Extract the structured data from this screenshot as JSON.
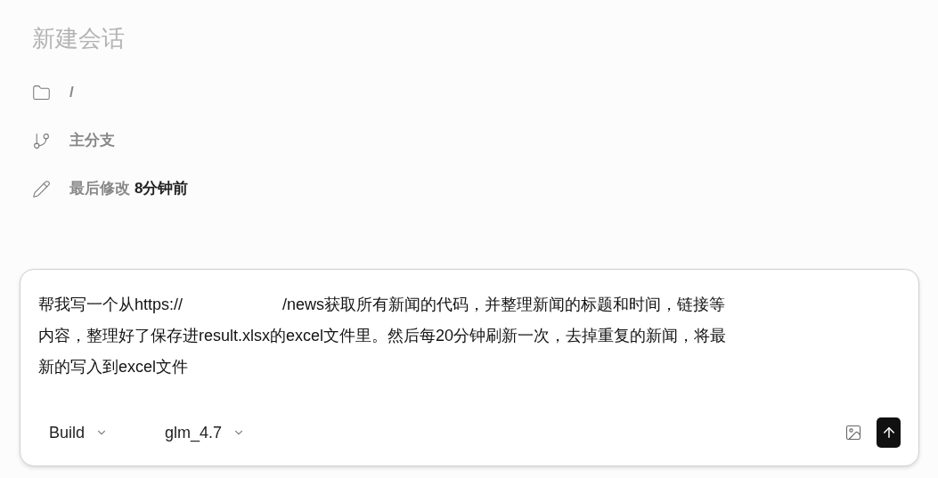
{
  "title": "新建会话",
  "info": [
    {
      "kind": "folder",
      "label": "/"
    },
    {
      "kind": "branch",
      "label": "主分支"
    },
    {
      "kind": "edited",
      "label": "最后修改",
      "value": "8分钟前"
    }
  ],
  "prompt": {
    "lines": [
      [
        "帮我写一个从https://",
        "/news获取所有新闻的代码，并整理新闻的标题和时间，链接等"
      ],
      [
        "内容，整理好了保存进result.xlsx的excel文件里。然后每20分钟刷新一次，去掉重复的新闻，将最"
      ],
      [
        "新的写入到excel文件"
      ]
    ],
    "agent": "Build",
    "model": "glm_4.7"
  }
}
